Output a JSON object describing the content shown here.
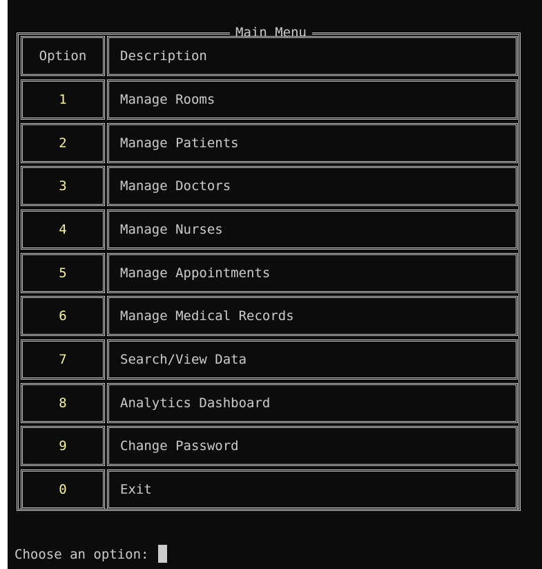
{
  "menu": {
    "title": "Main Menu",
    "headers": {
      "option": "Option",
      "description": "Description"
    },
    "items": [
      {
        "option": "1",
        "description": "Manage Rooms"
      },
      {
        "option": "2",
        "description": "Manage Patients"
      },
      {
        "option": "3",
        "description": "Manage Doctors"
      },
      {
        "option": "4",
        "description": "Manage Nurses"
      },
      {
        "option": "5",
        "description": "Manage Appointments"
      },
      {
        "option": "6",
        "description": "Manage Medical Records"
      },
      {
        "option": "7",
        "description": "Search/View Data"
      },
      {
        "option": "8",
        "description": "Analytics Dashboard"
      },
      {
        "option": "9",
        "description": "Change Password"
      },
      {
        "option": "0",
        "description": "Exit"
      }
    ]
  },
  "prompt": {
    "text": "Choose an option: "
  },
  "colors": {
    "background": "#0c0c0c",
    "text": "#cccccc",
    "option_number": "#f9f1a5"
  }
}
